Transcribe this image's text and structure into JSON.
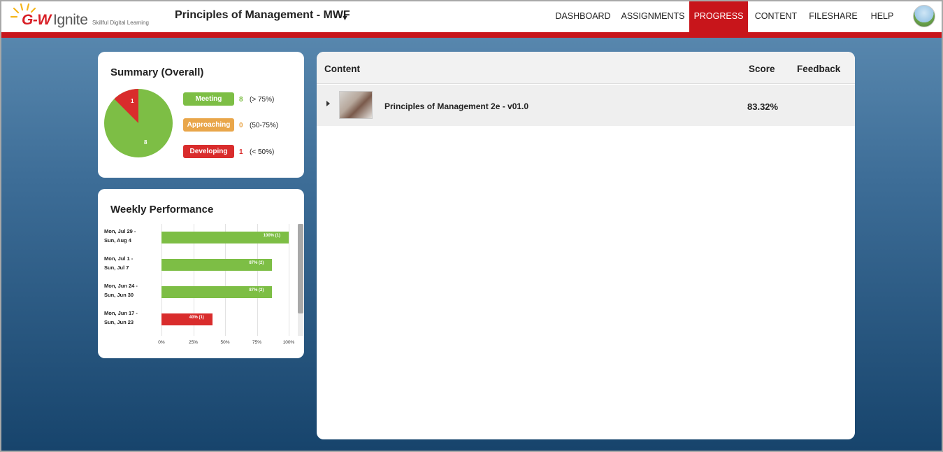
{
  "header": {
    "logo": {
      "brand": "G-W",
      "brand2": "Ignite",
      "tagline": "Skillful Digital Learning"
    },
    "course_title": "Principles of Management - MWF",
    "nav": [
      "DASHBOARD",
      "ASSIGNMENTS",
      "PROGRESS",
      "CONTENT",
      "FILESHARE",
      "HELP"
    ],
    "active_nav": "PROGRESS"
  },
  "colors": {
    "brand_red": "#c8151b",
    "meeting": "#7dbe45",
    "approaching": "#e9a64a",
    "developing": "#d92c2c"
  },
  "summary": {
    "title": "Summary (Overall)",
    "pie": {
      "meeting": 8,
      "developing": 1,
      "meeting_label": "8",
      "developing_label": "1"
    },
    "legend": [
      {
        "label": "Meeting",
        "count": "8",
        "range": "(> 75%)"
      },
      {
        "label": "Approaching",
        "count": "0",
        "range": "(50-75%)"
      },
      {
        "label": "Developing",
        "count": "1",
        "range": "(< 50%)"
      }
    ]
  },
  "weekly": {
    "title": "Weekly Performance",
    "weeks": [
      {
        "line1": "Mon, Jul 29 -",
        "line2": "Sun, Aug 4",
        "label": "100% (1)"
      },
      {
        "line1": "Mon, Jul 1 -",
        "line2": "Sun, Jul 7",
        "label": "87% (2)"
      },
      {
        "line1": "Mon, Jun 24 -",
        "line2": "Sun, Jun 30",
        "label": "87% (2)"
      },
      {
        "line1": "Mon, Jun 17 -",
        "line2": "Sun, Jun 23",
        "label": "40% (1)"
      }
    ],
    "ticks": [
      "0%",
      "25%",
      "50%",
      "75%",
      "100%"
    ]
  },
  "chart_data": {
    "type": "bar",
    "categories": [
      "Mon, Jul 29 - Sun, Aug 4",
      "Mon, Jul 1 - Sun, Jul 7",
      "Mon, Jun 24 - Sun, Jun 30",
      "Mon, Jun 17 - Sun, Jun 23"
    ],
    "values": [
      100,
      87,
      87,
      40
    ],
    "counts": [
      1,
      2,
      2,
      1
    ],
    "xlim": [
      0,
      100
    ],
    "orientation": "horizontal"
  },
  "content_table": {
    "headers": {
      "content": "Content",
      "score": "Score",
      "feedback": "Feedback"
    },
    "rows": [
      {
        "title": "Principles of Management 2e - v01.0",
        "score": "83.32%",
        "feedback": ""
      }
    ]
  }
}
